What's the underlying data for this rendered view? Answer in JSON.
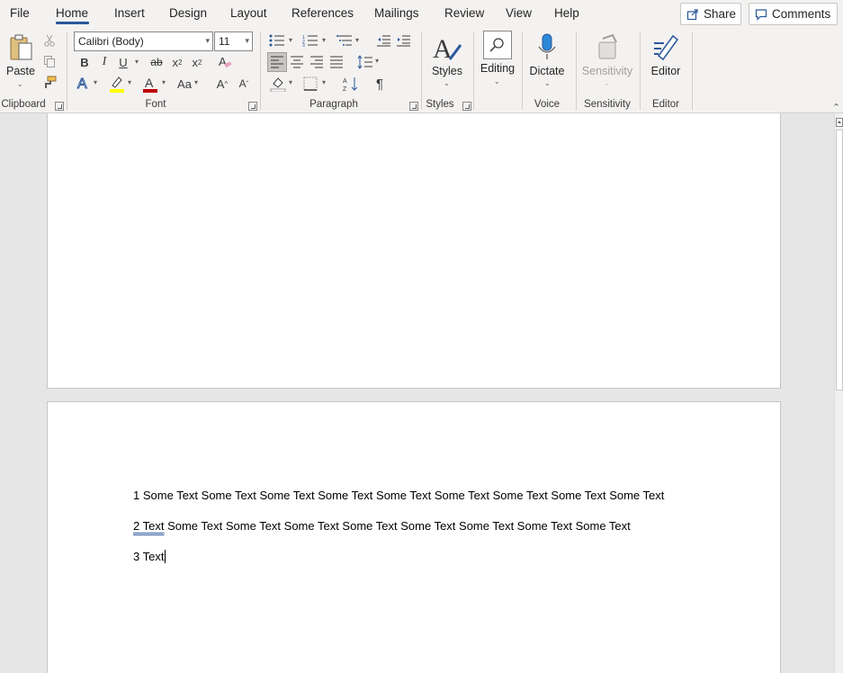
{
  "tabs": [
    "File",
    "Home",
    "Insert",
    "Design",
    "Layout",
    "References",
    "Mailings",
    "Review",
    "View",
    "Help"
  ],
  "active_tab": "Home",
  "share_label": "Share",
  "comments_label": "Comments",
  "clipboard": {
    "paste_label": "Paste",
    "group_label": "Clipboard"
  },
  "font": {
    "family": "Calibri (Body)",
    "size": "11",
    "group_label": "Font",
    "bold": "B",
    "italic": "I",
    "underline": "U",
    "strike": "ab",
    "subscript": "x",
    "superscript": "x",
    "grow": "A",
    "shrink": "A",
    "case": "Aa"
  },
  "paragraph": {
    "group_label": "Paragraph",
    "show_marks": "¶"
  },
  "styles": {
    "label": "Styles",
    "group_label": "Styles"
  },
  "editing": {
    "label": "Editing"
  },
  "voice": {
    "dictate_label": "Dictate",
    "group_label": "Voice"
  },
  "sensitivity": {
    "label": "Sensitivity",
    "group_label": "Sensitivity"
  },
  "editor": {
    "label": "Editor",
    "group_label": "Editor"
  },
  "colors": {
    "accent": "#2b579a",
    "highlight": "#ffff00",
    "font_color": "#c00000"
  },
  "document": {
    "paragraphs": [
      {
        "num": "1",
        "first": "Some Text",
        "rest": " Some Text Some Text Some Text Some Text Some Text Some Text Some Text Some Text"
      },
      {
        "num": "2 ",
        "first": "Text",
        "rest": " Some Text Some Text Some Text Some Text Some Text Some Text Some Text Some Text"
      },
      {
        "num": "3",
        "first": "Text",
        "rest": ""
      }
    ]
  }
}
